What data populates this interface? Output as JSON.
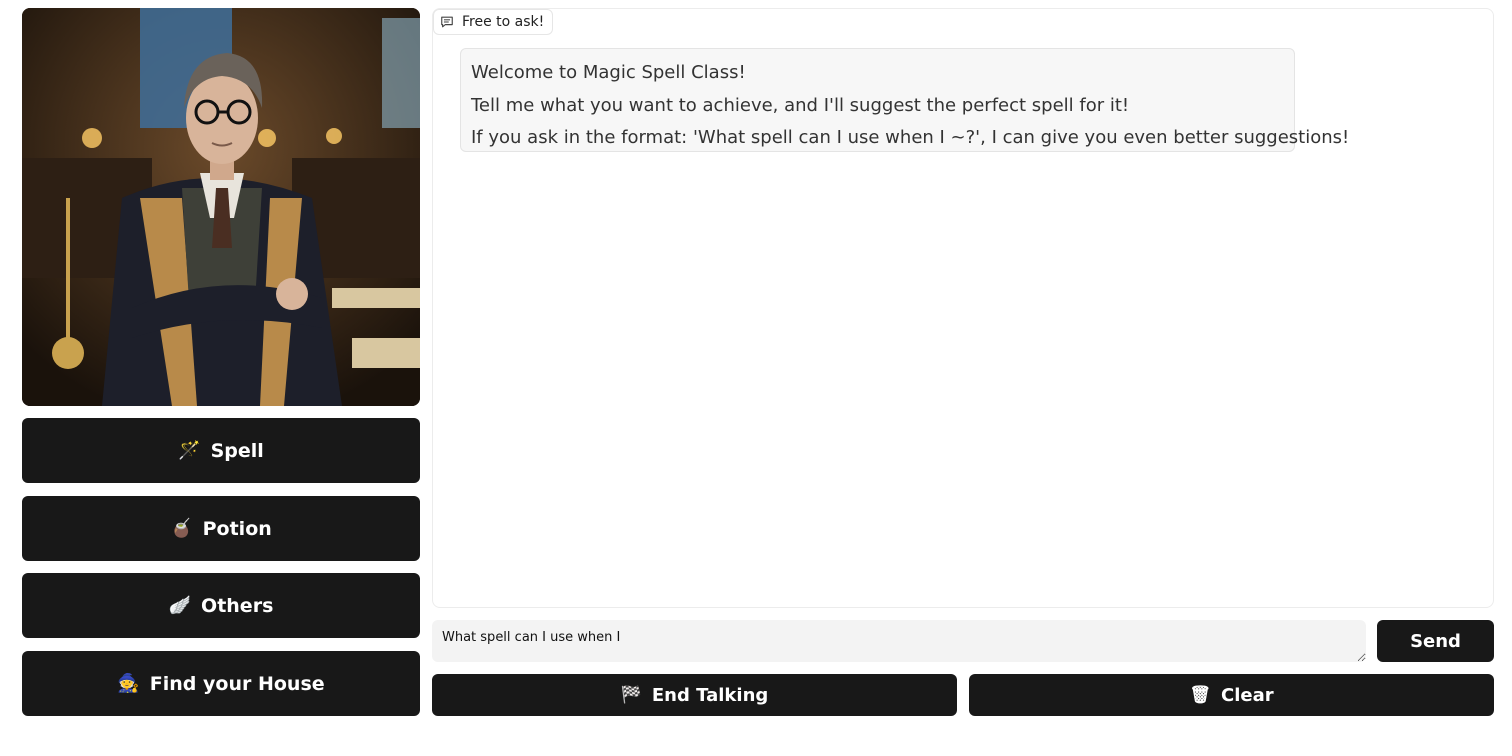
{
  "sidebar": {
    "buttons": [
      {
        "icon": "magic-wand-icon",
        "emoji": "🪄",
        "label": "Spell"
      },
      {
        "icon": "potion-icon",
        "emoji": "🧉",
        "label": "Potion"
      },
      {
        "icon": "golden-snitch-icon",
        "emoji": "🪽",
        "label": "Others"
      },
      {
        "icon": "wizard-hat-icon",
        "emoji": "🧙",
        "label": "Find your House"
      }
    ]
  },
  "chat": {
    "label": "Free to ask!",
    "messages": [
      {
        "role": "assistant",
        "lines": [
          "Welcome to Magic Spell Class!",
          "Tell me what you want to achieve, and I'll suggest the perfect spell for it!",
          "If you ask in the format: 'What spell can I use when I ~?', I can give you even better suggestions!"
        ]
      }
    ]
  },
  "input": {
    "value": "What spell can I use when I"
  },
  "actions": {
    "send_label": "Send",
    "end_label": "End Talking",
    "end_emoji": "🏁",
    "clear_label": "Clear",
    "clear_emoji": "🗑"
  }
}
